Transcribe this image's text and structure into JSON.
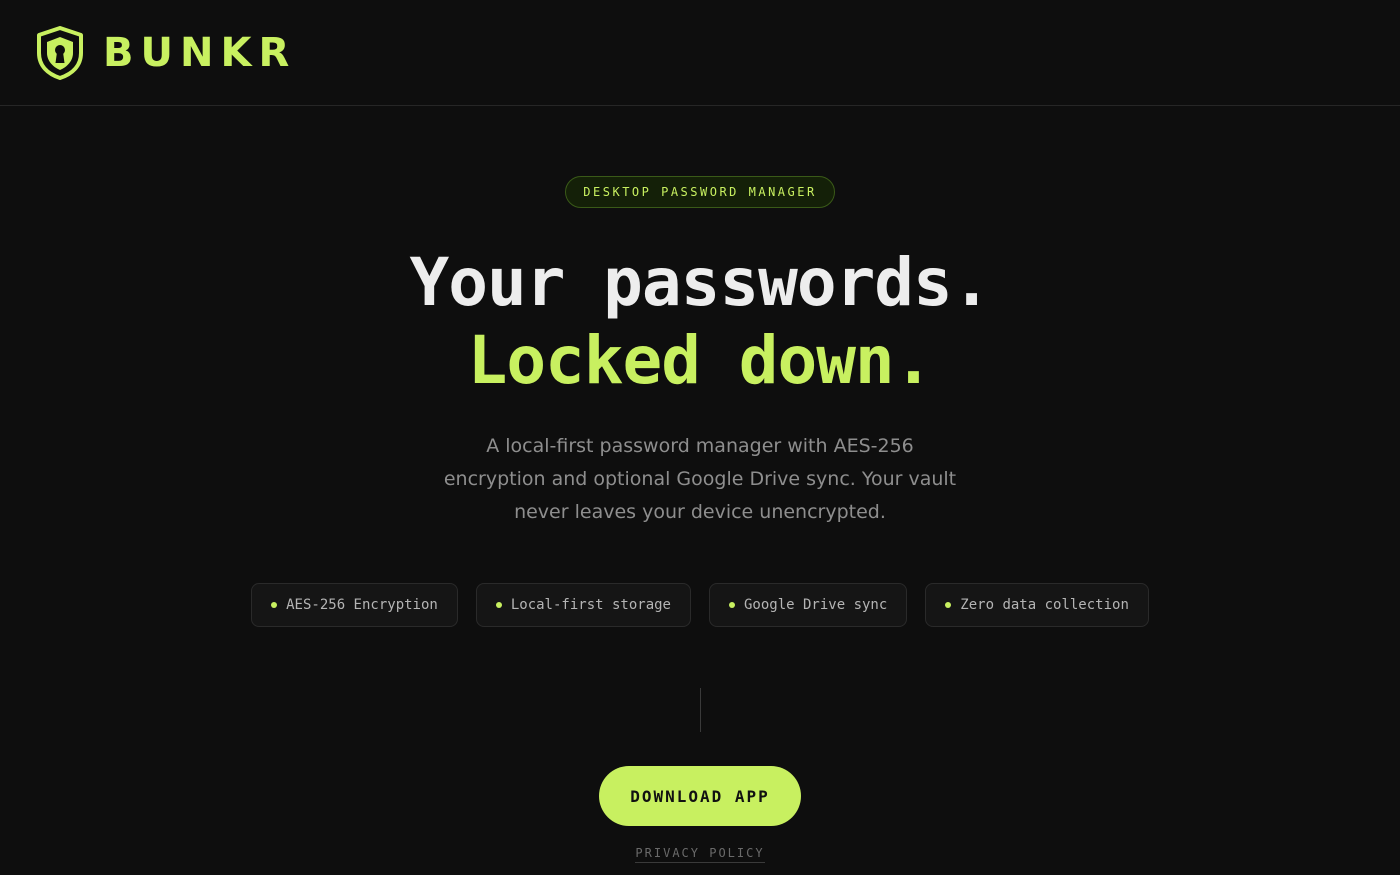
{
  "brand": {
    "name": "BUNKR",
    "logo_icon": "shield-keyhole-icon",
    "accent_color": "#c8f060"
  },
  "hero": {
    "badge": "DESKTOP PASSWORD MANAGER",
    "headline_line1": "Your passwords.",
    "headline_line2": "Locked down.",
    "subtitle": "A local-first password manager with AES-256 encryption and optional Google Drive sync. Your vault never leaves your device unencrypted."
  },
  "features": [
    {
      "label": "AES-256 Encryption"
    },
    {
      "label": "Local-first storage"
    },
    {
      "label": "Google Drive sync"
    },
    {
      "label": "Zero data collection"
    }
  ],
  "cta": {
    "download_label": "DOWNLOAD APP",
    "privacy_label": "PRIVACY POLICY"
  }
}
